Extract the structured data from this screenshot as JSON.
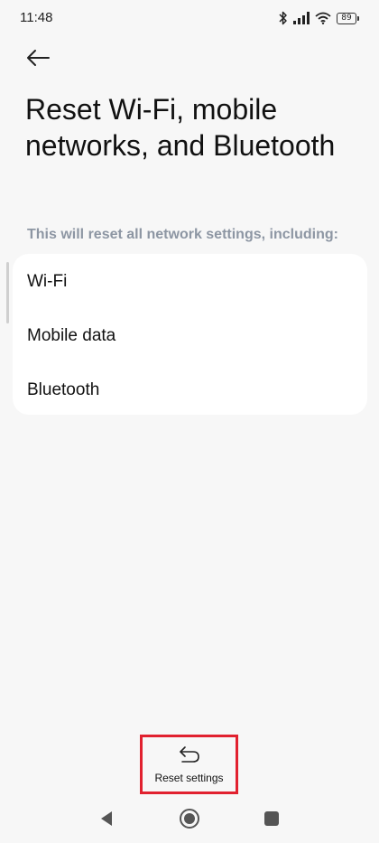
{
  "status_bar": {
    "time": "11:48",
    "battery_level": "89",
    "icons": [
      "bluetooth-icon",
      "signal-icon",
      "wifi-icon",
      "battery-icon"
    ]
  },
  "header": {
    "back_icon": "arrow-left-icon",
    "title": "Reset Wi-Fi, mobile networks, and Bluetooth"
  },
  "main": {
    "subtitle": "This will reset all network settings, including:",
    "items": [
      {
        "label": "Wi-Fi"
      },
      {
        "label": "Mobile data"
      },
      {
        "label": "Bluetooth"
      }
    ]
  },
  "action": {
    "icon": "undo-arrow-icon",
    "label": "Reset settings",
    "highlight_color": "#e1212f"
  },
  "navigation_bar": {
    "buttons": [
      "back-triangle-icon",
      "home-circle-icon",
      "recents-square-icon"
    ]
  },
  "colors": {
    "background": "#f7f7f7",
    "card": "#ffffff",
    "subtitle": "#8d96a3"
  }
}
